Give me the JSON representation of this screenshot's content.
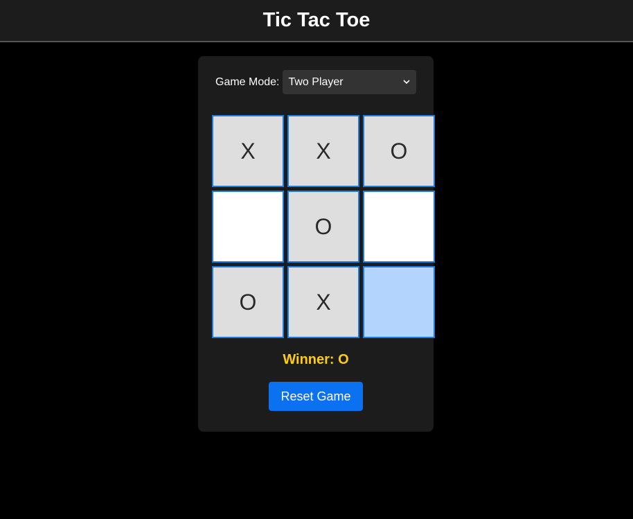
{
  "header": {
    "title": "Tic Tac Toe"
  },
  "mode": {
    "label": "Game Mode:",
    "selected": "Two Player"
  },
  "board": {
    "cells": [
      "X",
      "X",
      "O",
      "",
      "O",
      "",
      "O",
      "X",
      ""
    ]
  },
  "status": {
    "text": "Winner: O"
  },
  "controls": {
    "reset_label": "Reset Game"
  },
  "colors": {
    "background": "#000000",
    "panel": "#1c1c1c",
    "cell_border": "#1e7be0",
    "cell_filled": "#dedede",
    "cell_empty": "#ffffff",
    "cell_hover": "#b3d4fc",
    "winner_text": "#ffcc11",
    "button": "#0a72f0"
  }
}
